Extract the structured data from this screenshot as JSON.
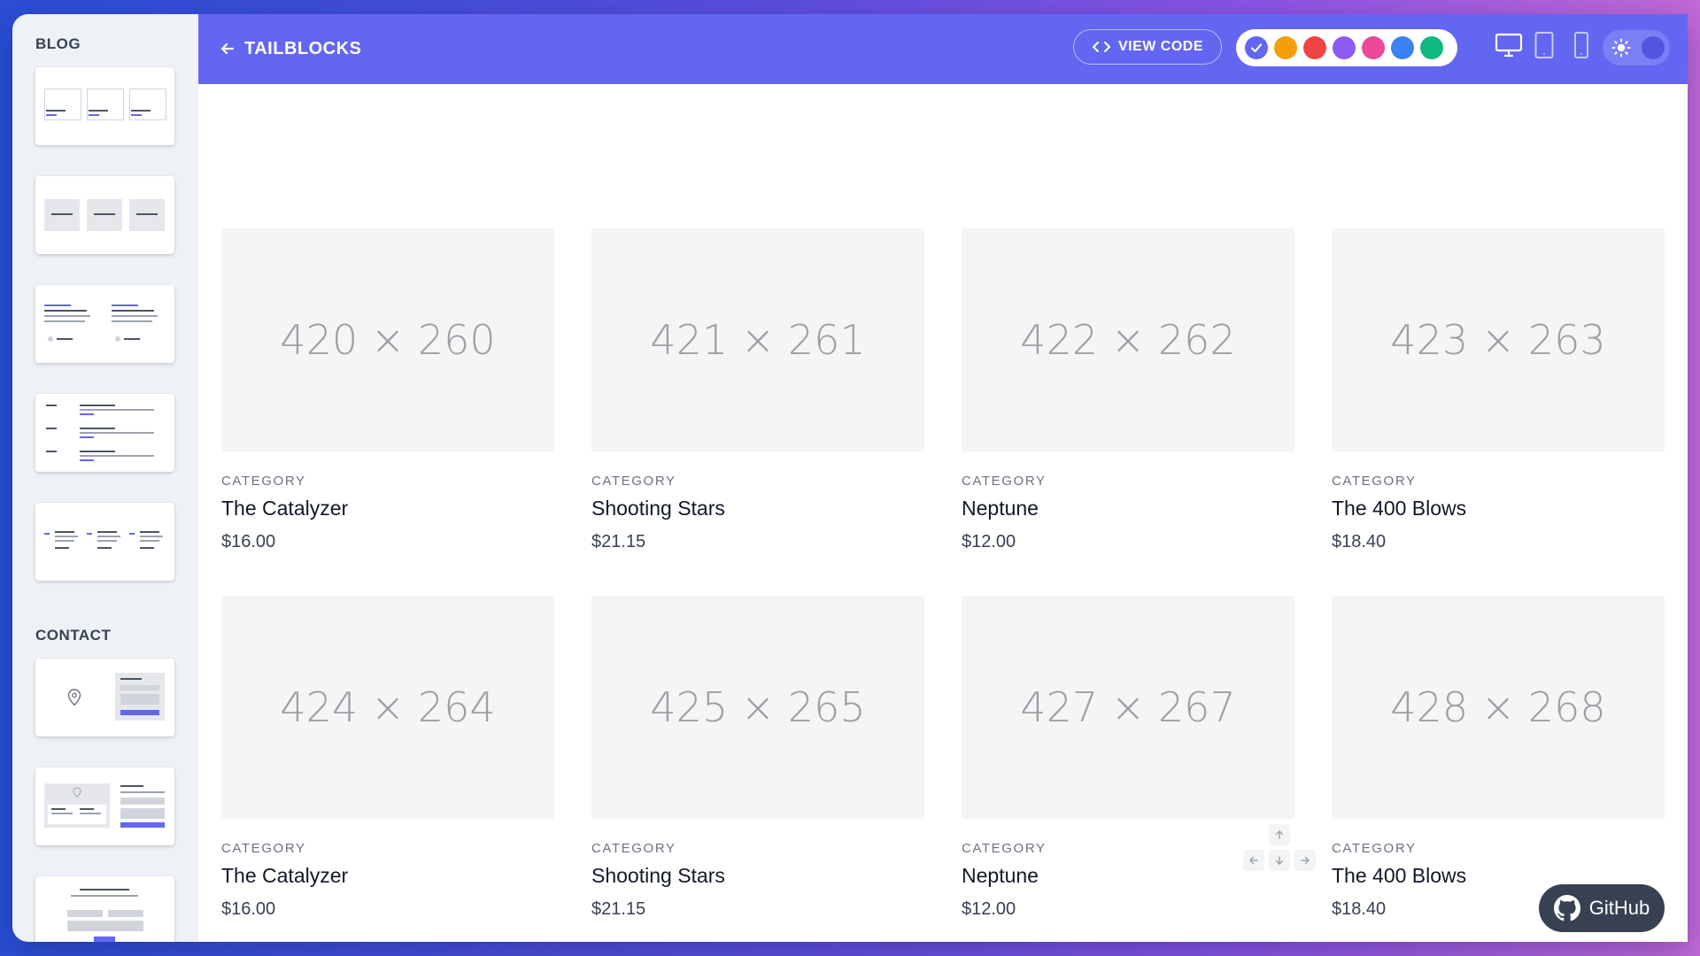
{
  "sidebar": {
    "sections": [
      {
        "title": "BLOG"
      },
      {
        "title": "CONTACT"
      }
    ]
  },
  "topbar": {
    "brand": "TAILBLOCKS",
    "view_code": "VIEW CODE",
    "colors": [
      "#6366f1",
      "#f59e0b",
      "#ef4444",
      "#8b5cf6",
      "#ec4899",
      "#3b82f6",
      "#10b981"
    ],
    "selected_color": "#6366f1",
    "devices": [
      "desktop-icon",
      "tablet-icon",
      "phone-icon"
    ],
    "theme_icon": "sun-icon"
  },
  "products": [
    {
      "image": "420 × 260",
      "category": "CATEGORY",
      "title": "The Catalyzer",
      "price": "$16.00"
    },
    {
      "image": "421 × 261",
      "category": "CATEGORY",
      "title": "Shooting Stars",
      "price": "$21.15"
    },
    {
      "image": "422 × 262",
      "category": "CATEGORY",
      "title": "Neptune",
      "price": "$12.00"
    },
    {
      "image": "423 × 263",
      "category": "CATEGORY",
      "title": "The 400 Blows",
      "price": "$18.40"
    },
    {
      "image": "424 × 264",
      "category": "CATEGORY",
      "title": "The Catalyzer",
      "price": "$16.00"
    },
    {
      "image": "425 × 265",
      "category": "CATEGORY",
      "title": "Shooting Stars",
      "price": "$21.15"
    },
    {
      "image": "427 × 267",
      "category": "CATEGORY",
      "title": "Neptune",
      "price": "$12.00"
    },
    {
      "image": "428 × 268",
      "category": "CATEGORY",
      "title": "The 400 Blows",
      "price": "$18.40"
    }
  ],
  "github": {
    "label": "GitHub"
  }
}
